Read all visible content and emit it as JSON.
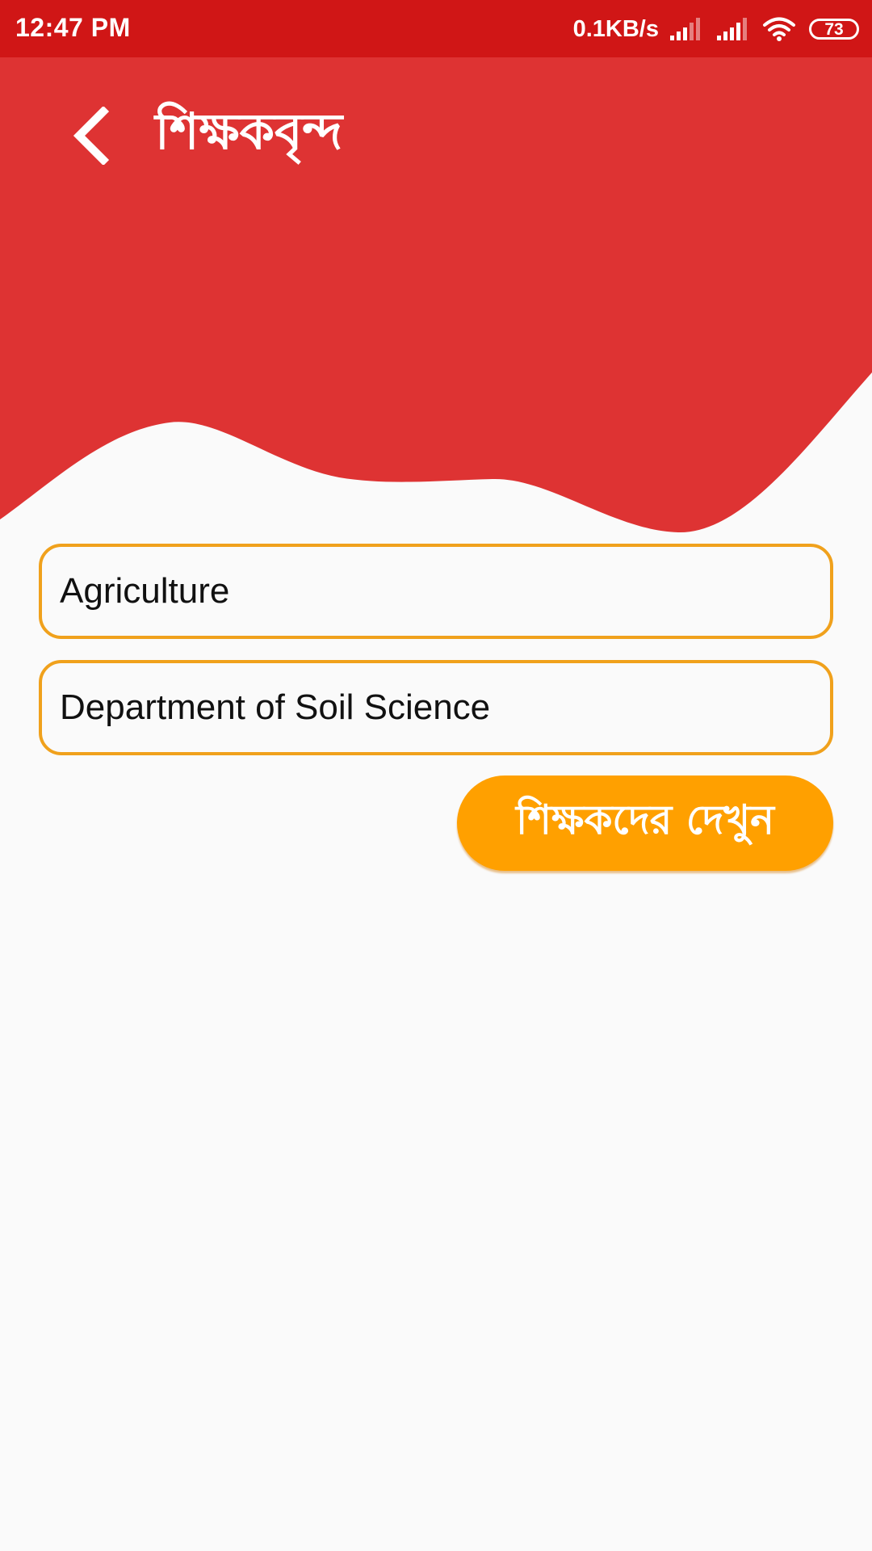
{
  "status_bar": {
    "time": "12:47 PM",
    "network_speed": "0.1KB/s",
    "battery_level": "73",
    "icons": [
      "signal-icon",
      "signal-icon",
      "wifi-icon",
      "battery-icon"
    ]
  },
  "header": {
    "title": "শিক্ষকবৃন্দ",
    "back_icon": "chevron-left-icon",
    "background_color": "#de3333"
  },
  "form": {
    "faculty_value": "Agriculture",
    "department_value": "Department of Soil Science",
    "field_border_color": "#f0a11c"
  },
  "actions": {
    "view_teachers_label": "শিক্ষকদের দেখুন",
    "button_color": "#ffa000"
  }
}
